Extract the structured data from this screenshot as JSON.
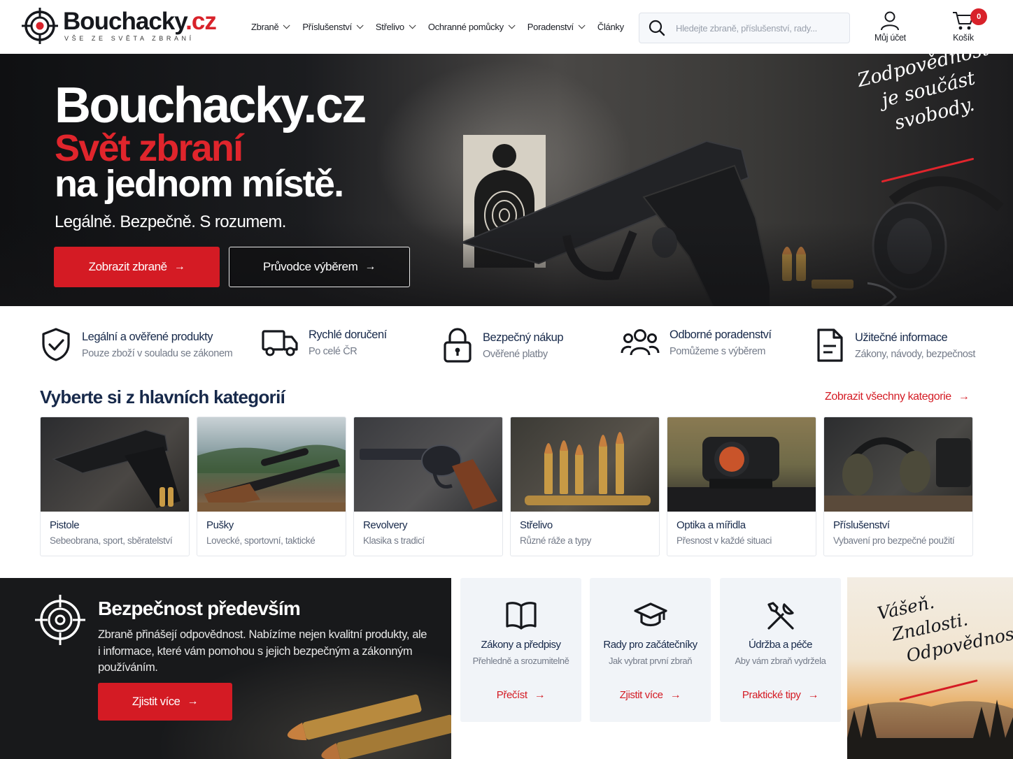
{
  "header": {
    "logo_name": "Bouchacky",
    "logo_tld": ".cz",
    "logo_tagline": "VŠE ZE SVĚTA ZBRANÍ",
    "nav": [
      {
        "label": "Zbraně",
        "dropdown": true
      },
      {
        "label": "Příslušenství",
        "dropdown": true
      },
      {
        "label": "Střelivo",
        "dropdown": true
      },
      {
        "label": "Ochranné pomůcky",
        "dropdown": true
      },
      {
        "label": "Poradenství",
        "dropdown": true
      },
      {
        "label": "Články",
        "dropdown": false
      }
    ],
    "search_placeholder": "Hledejte zbraně, příslušenství, rady...",
    "account_label": "Můj účet",
    "cart_label": "Košík",
    "cart_count": "0"
  },
  "hero": {
    "title": "Bouchacky.cz",
    "subtitle_red": "Svět zbraní",
    "subtitle_white": "na jednom místě.",
    "tagline": "Legálně. Bezpečně. S rozumem.",
    "primary_button": "Zobrazit zbraně",
    "secondary_button": "Průvodce výběrem",
    "quote_lines": [
      "Zodpovědnost",
      "je součást",
      "svobody."
    ]
  },
  "features": [
    {
      "icon": "shield-check-icon",
      "title": "Legální a ověřené produkty",
      "subtitle": "Pouze zboží v souladu se zákonem"
    },
    {
      "icon": "truck-icon",
      "title": "Rychlé doručení",
      "subtitle": "Po celé ČR"
    },
    {
      "icon": "lock-icon",
      "title": "Bezpečný nákup",
      "subtitle": "Ověřené platby"
    },
    {
      "icon": "users-icon",
      "title": "Odborné poradenství",
      "subtitle": "Pomůžeme s výběrem"
    },
    {
      "icon": "document-icon",
      "title": "Užitečné informace",
      "subtitle": "Zákony, návody, bezpečnost"
    }
  ],
  "categories": {
    "heading": "Vyberte si z hlavních kategorií",
    "view_all": "Zobrazit všechny kategorie",
    "items": [
      {
        "name": "Pistole",
        "description": "Sebeobrana, sport, sběratelství"
      },
      {
        "name": "Pušky",
        "description": "Lovecké, sportovní, taktické"
      },
      {
        "name": "Revolvery",
        "description": "Klasika s tradicí"
      },
      {
        "name": "Střelivo",
        "description": "Různé ráže a typy"
      },
      {
        "name": "Optika a mířidla",
        "description": "Přesnost v každé situaci"
      },
      {
        "name": "Příslušenství",
        "description": "Vybavení pro bezpečné použití"
      }
    ]
  },
  "safety": {
    "title": "Bezpečnost především",
    "text": "Zbraně přinášejí odpovědnost. Nabízíme nejen kvalitní produkty, ale i informace, které vám pomohou s jejich bezpečným a zákonným používáním.",
    "button": "Zjistit více"
  },
  "info_cards": [
    {
      "icon": "book-icon",
      "title": "Zákony a předpisy",
      "subtitle": "Přehledně a srozumitelně",
      "link": "Přečíst"
    },
    {
      "icon": "graduation-cap-icon",
      "title": "Rady pro začátečníky",
      "subtitle": "Jak vybrat první zbraň",
      "link": "Zjistit více"
    },
    {
      "icon": "tools-icon",
      "title": "Údržba a péče",
      "subtitle": "Aby vám zbraň vydržela",
      "link": "Praktické tipy"
    }
  ],
  "sunset_quote": [
    "Vášeň.",
    "Znalosti.",
    "Odpovědnost."
  ],
  "colors": {
    "accent": "#d41b24",
    "navy": "#17294a",
    "muted": "#737a88"
  }
}
